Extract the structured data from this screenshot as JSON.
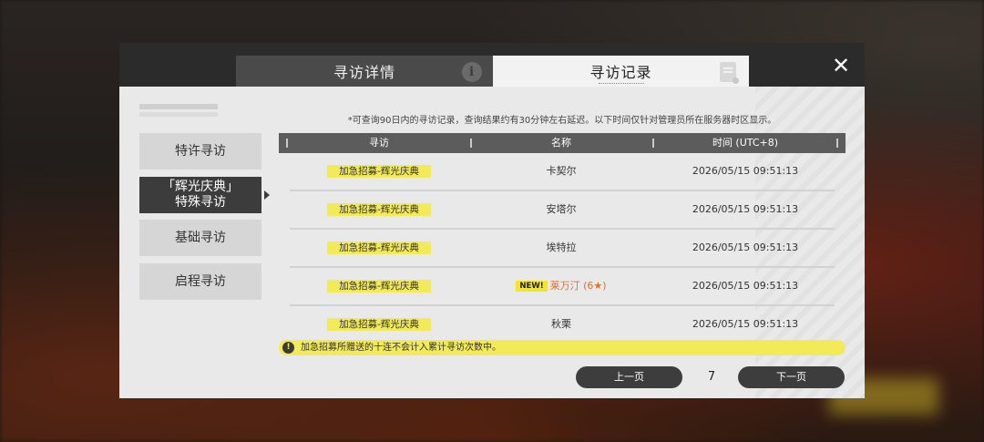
{
  "tabs": {
    "detail": "寻访详情",
    "record": "寻访记录"
  },
  "sidebar": {
    "items": [
      {
        "label": "特许寻访"
      },
      {
        "label_line1": "「辉光庆典」",
        "label_line2": "特殊寻访"
      },
      {
        "label": "基础寻访"
      },
      {
        "label": "启程寻访"
      }
    ],
    "active_index": 1
  },
  "notice": "*可查询90日内的寻访记录，查询结果约有30分钟左右延迟。以下时间仅针对管理员所在服务器时区显示。",
  "table": {
    "headers": [
      "寻访",
      "名称",
      "时间 (UTC+8)"
    ],
    "rows": [
      {
        "type": "加急招募-辉光庆典",
        "name": "卡契尔",
        "time": "2026/05/15 09:51:13"
      },
      {
        "type": "加急招募-辉光庆典",
        "name": "安塔尔",
        "time": "2026/05/15 09:51:13"
      },
      {
        "type": "加急招募-辉光庆典",
        "name": "埃特拉",
        "time": "2026/05/15 09:51:13"
      },
      {
        "type": "加急招募-辉光庆典",
        "new_badge": "NEW!",
        "name": "莱万汀",
        "rarity": "(6★)",
        "time": "2026/05/15 09:51:13"
      },
      {
        "type": "加急招募-辉光庆典",
        "name": "秋栗",
        "time": "2026/05/15 09:51:13"
      }
    ]
  },
  "warning": "加急招募所赠送的十连不会计入累计寻访次数中。",
  "pager": {
    "prev": "上一页",
    "page": "7",
    "next": "下一页"
  },
  "icons": {
    "info": "info-icon",
    "record": "document-icon",
    "close": "close-icon",
    "warning": "exclamation-icon"
  },
  "colors": {
    "highlight_yellow": "#f3ea5a",
    "new_name_orange": "#e0702a",
    "dark_panel": "#3c3c3c"
  }
}
